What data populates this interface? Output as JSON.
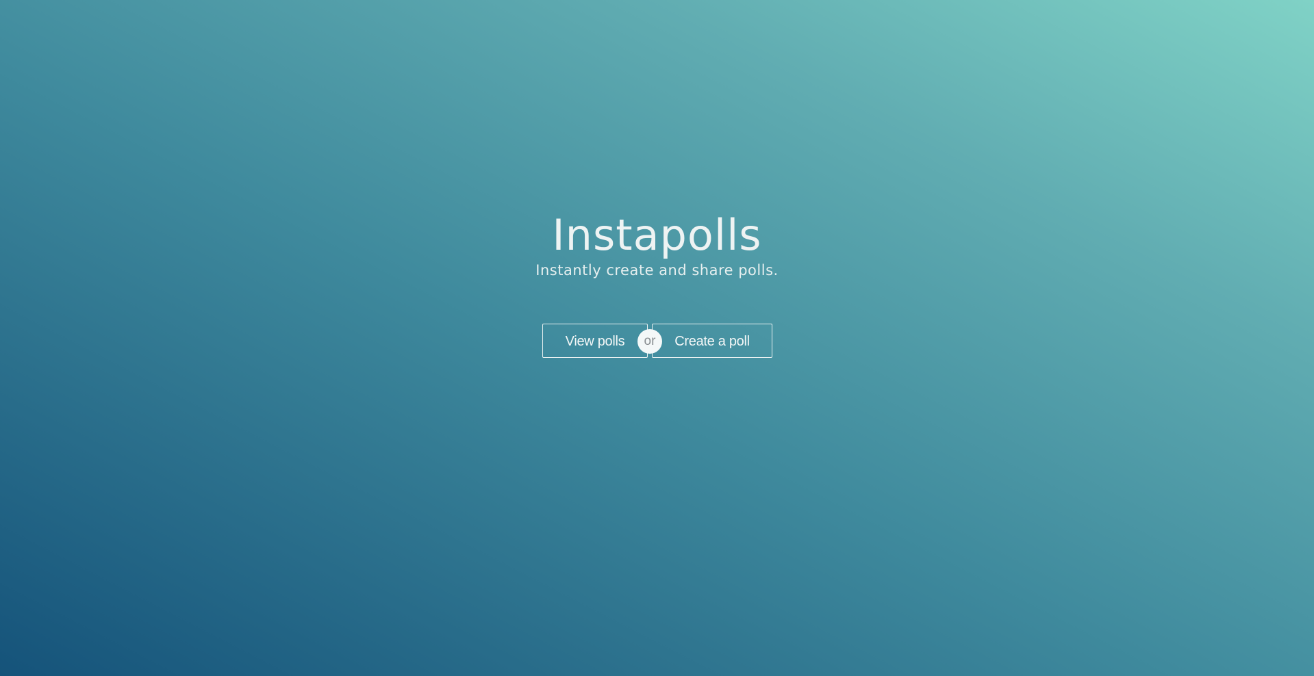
{
  "app": {
    "title": "Instapolls",
    "tagline": "Instantly create and share polls."
  },
  "actions": {
    "view_label": "View polls",
    "separator": "or",
    "create_label": "Create a poll"
  },
  "colors": {
    "gradient_bottom_left": "#15537a",
    "gradient_top_right": "#80d2c6",
    "text": "#eef3f3",
    "separator_bg": "#f4f8f8",
    "separator_text": "#8a8f92"
  }
}
